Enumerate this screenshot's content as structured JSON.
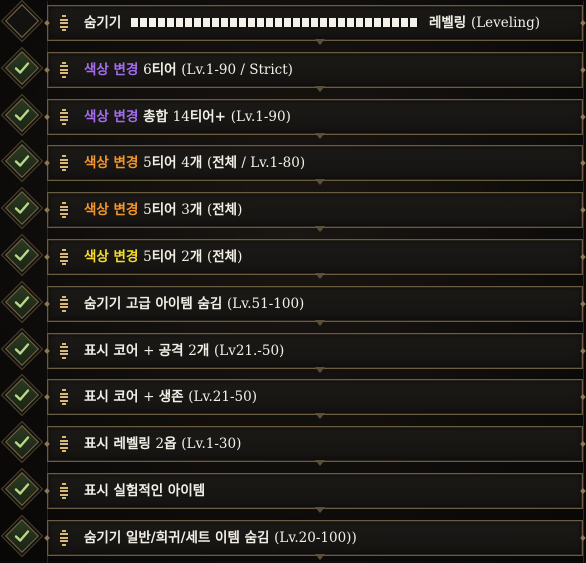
{
  "rows": [
    {
      "enabled": false,
      "name": "row-hide-leveling",
      "parts": [
        {
          "t": "숨기기 ",
          "c": ""
        },
        {
          "t": "BAR",
          "c": "bar"
        },
        {
          "t": "레벨링 ",
          "c": ""
        },
        {
          "t": "(Leveling)",
          "c": "r"
        }
      ]
    },
    {
      "enabled": true,
      "name": "row-color-6tier-strict",
      "parts": [
        {
          "t": "색상 변경 ",
          "c": "p"
        },
        {
          "t": "6",
          "c": "r"
        },
        {
          "t": "티어 ",
          "c": ""
        },
        {
          "t": "(Lv.1-90 / Strict)",
          "c": "r"
        }
      ]
    },
    {
      "enabled": true,
      "name": "row-color-total-14tier",
      "parts": [
        {
          "t": "색상 변경 ",
          "c": "p"
        },
        {
          "t": "총합 ",
          "c": ""
        },
        {
          "t": "14",
          "c": "r"
        },
        {
          "t": "티어+ ",
          "c": ""
        },
        {
          "t": "(Lv.1-90)",
          "c": "r"
        }
      ]
    },
    {
      "enabled": true,
      "name": "row-color-5tier-4",
      "parts": [
        {
          "t": "색상 변경 ",
          "c": "o"
        },
        {
          "t": "5",
          "c": "r"
        },
        {
          "t": "티어 ",
          "c": ""
        },
        {
          "t": "4",
          "c": "r"
        },
        {
          "t": "개 ",
          "c": ""
        },
        {
          "t": "(",
          "c": "r"
        },
        {
          "t": "전체",
          "c": ""
        },
        {
          "t": " / Lv.1-80)",
          "c": "r"
        }
      ]
    },
    {
      "enabled": true,
      "name": "row-color-5tier-3",
      "parts": [
        {
          "t": "색상 변경 ",
          "c": "o"
        },
        {
          "t": "5",
          "c": "r"
        },
        {
          "t": "티어 ",
          "c": ""
        },
        {
          "t": "3",
          "c": "r"
        },
        {
          "t": "개  ",
          "c": ""
        },
        {
          "t": "(",
          "c": "r"
        },
        {
          "t": "전체",
          "c": ""
        },
        {
          "t": ")",
          "c": "r"
        }
      ]
    },
    {
      "enabled": true,
      "name": "row-color-5tier-2",
      "parts": [
        {
          "t": "색상 변경 ",
          "c": "y"
        },
        {
          "t": "5",
          "c": "r"
        },
        {
          "t": "티어 ",
          "c": ""
        },
        {
          "t": "2",
          "c": "r"
        },
        {
          "t": "개 ",
          "c": ""
        },
        {
          "t": "(",
          "c": "r"
        },
        {
          "t": "전체",
          "c": ""
        },
        {
          "t": ")",
          "c": "r"
        }
      ]
    },
    {
      "enabled": true,
      "name": "row-hide-advanced",
      "parts": [
        {
          "t": "숨기기 고급 아이템 숨김 ",
          "c": ""
        },
        {
          "t": "(Lv.51-100)",
          "c": "r"
        }
      ]
    },
    {
      "enabled": true,
      "name": "row-show-core-attack",
      "parts": [
        {
          "t": "표시 코어 ",
          "c": ""
        },
        {
          "t": "+ ",
          "c": "r"
        },
        {
          "t": "공격 ",
          "c": ""
        },
        {
          "t": "2",
          "c": "r"
        },
        {
          "t": "개 ",
          "c": ""
        },
        {
          "t": "(Lv21.-50)",
          "c": "r"
        }
      ]
    },
    {
      "enabled": true,
      "name": "row-show-core-survival",
      "parts": [
        {
          "t": "표시 코어 ",
          "c": ""
        },
        {
          "t": "+ ",
          "c": "r"
        },
        {
          "t": "생존 ",
          "c": ""
        },
        {
          "t": "(Lv.21-50)",
          "c": "r"
        }
      ]
    },
    {
      "enabled": true,
      "name": "row-show-leveling-2",
      "parts": [
        {
          "t": "표시 레벨링 ",
          "c": ""
        },
        {
          "t": "2",
          "c": "r"
        },
        {
          "t": "옵  ",
          "c": ""
        },
        {
          "t": "(Lv.1-30)",
          "c": "r"
        }
      ]
    },
    {
      "enabled": true,
      "name": "row-show-experimental",
      "parts": [
        {
          "t": "표시 실험적인 아이템",
          "c": ""
        }
      ]
    },
    {
      "enabled": true,
      "name": "row-hide-normal-rare-set",
      "parts": [
        {
          "t": "숨기기 일반/희귀/세트 이템 숨김 ",
          "c": ""
        },
        {
          "t": "(Lv.20-100))",
          "c": "r"
        }
      ]
    }
  ]
}
